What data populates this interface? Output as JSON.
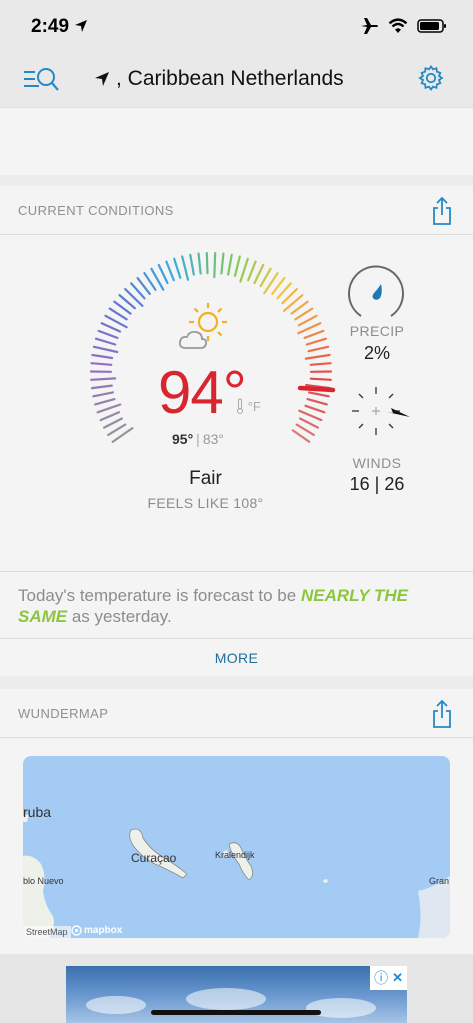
{
  "status_bar": {
    "time": "2:49"
  },
  "nav": {
    "location_title": ", Caribbean Netherlands"
  },
  "current_conditions": {
    "header": "CURRENT CONDITIONS",
    "temperature": "94°",
    "unit": "°F",
    "high": "95°",
    "separator": "|",
    "low": "83°",
    "condition": "Fair",
    "feels_like": "FEELS LIKE 108°",
    "precip_label": "PRECIP",
    "precip_value": "2%",
    "winds_label": "WINDS",
    "winds_value": "16 | 26",
    "forecast_prefix": "Today's temperature is forecast to be ",
    "forecast_highlight": "NEARLY THE SAME",
    "forecast_suffix": " as yesterday.",
    "more": "MORE",
    "accent_color": "#d7262f",
    "highlight_color": "#8cc63f"
  },
  "wundermap": {
    "header": "WUNDERMAP",
    "labels": {
      "aruba": "ruba",
      "curacao": "Curaçao",
      "kralendijk": "Kralendijk",
      "punto_fijo": "blo Nuevo",
      "gran": "Gran"
    },
    "attribution": "StreetMap",
    "logo": "mapbox"
  },
  "ad": {
    "info_icon": "ⓘ",
    "close_icon": "✕"
  }
}
